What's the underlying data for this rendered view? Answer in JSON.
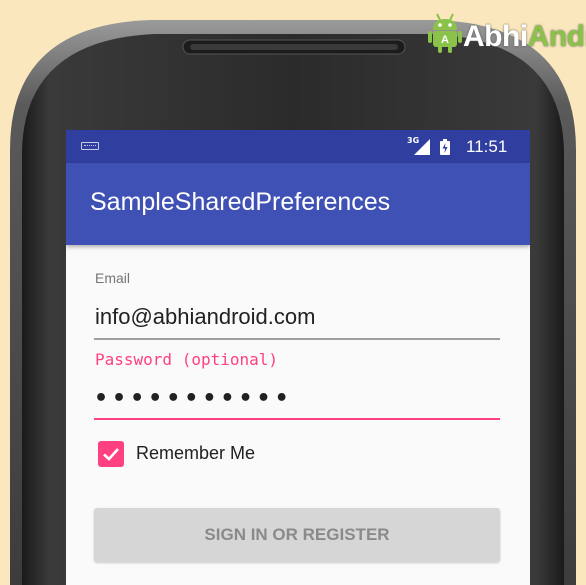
{
  "status_bar": {
    "network": "3G",
    "time": "11:51",
    "icons": [
      "keyboard-icon",
      "signal-icon",
      "battery-icon"
    ]
  },
  "app_bar": {
    "title": "SampleSharedPreferences"
  },
  "form": {
    "email_label": "Email",
    "email_value": "info@abhiandroid.com",
    "password_label": "Password (optional)",
    "password_value": "•••••••••••",
    "remember_label": "Remember Me",
    "remember_checked": true,
    "submit_label": "SIGN IN OR REGISTER"
  },
  "logo": {
    "text": "AbhiAndroid"
  },
  "colors": {
    "primary": "#3f51b5",
    "primary_dark": "#303f9f",
    "accent": "#ff4081",
    "logo_green": "#8bc34a"
  }
}
